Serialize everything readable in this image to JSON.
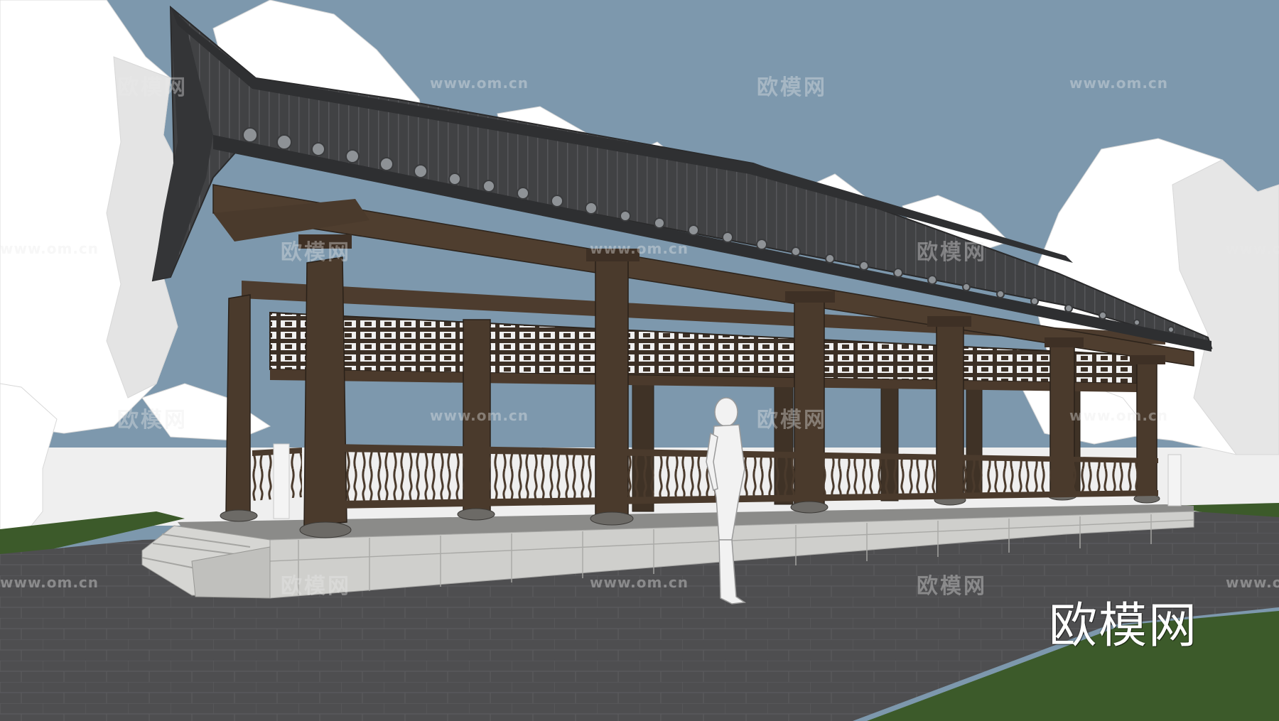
{
  "scene": {
    "subject": "Traditional Chinese corridor pavilion (wooden, tiled hip roof) in a 3D SketchUp-style rendering",
    "colors": {
      "sky": "#7d98ad",
      "ground_far": "#eeeeee",
      "grass": "#3b5a2a",
      "paving": "#4c4c4e",
      "platform": "#c9c9c6",
      "wood": "#4a3a2c",
      "roof": "#3f4042",
      "figure": "#f2f2f2"
    }
  },
  "watermarks": {
    "url": "www.om.cn",
    "brand": "欧模网"
  },
  "logo": {
    "text": "欧模网"
  }
}
